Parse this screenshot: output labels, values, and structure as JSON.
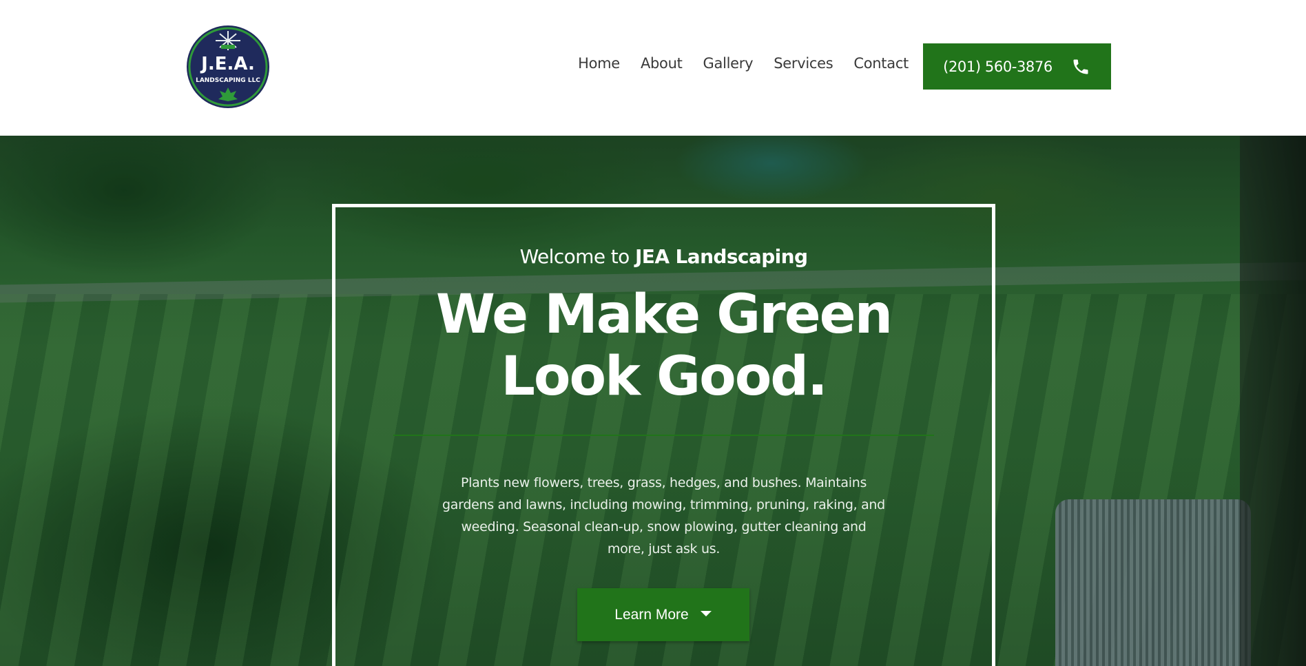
{
  "brand": {
    "logo_text": "J.E.A.",
    "logo_subtext": "LANDSCAPING LLC",
    "colors": {
      "primary_green": "#21741a",
      "logo_navy": "#1f2a5c"
    }
  },
  "nav": {
    "items": [
      "Home",
      "About",
      "Gallery",
      "Services",
      "Contact"
    ]
  },
  "header": {
    "phone_label": "(201) 560-3876",
    "phone_icon": "phone-icon"
  },
  "hero": {
    "welcome_prefix": "Welcome to ",
    "welcome_brand": "JEA Landscaping",
    "headline_line1": "We Make Green",
    "headline_line2": "Look Good.",
    "description": "Plants new flowers, trees, grass, hedges, and bushes. Maintains gardens and lawns, including mowing, trimming, pruning, raking, and weeding. Seasonal clean-up, snow plowing, gutter cleaning and more, just ask us.",
    "cta_label": "Learn More",
    "cta_icon": "caret-down-icon"
  }
}
